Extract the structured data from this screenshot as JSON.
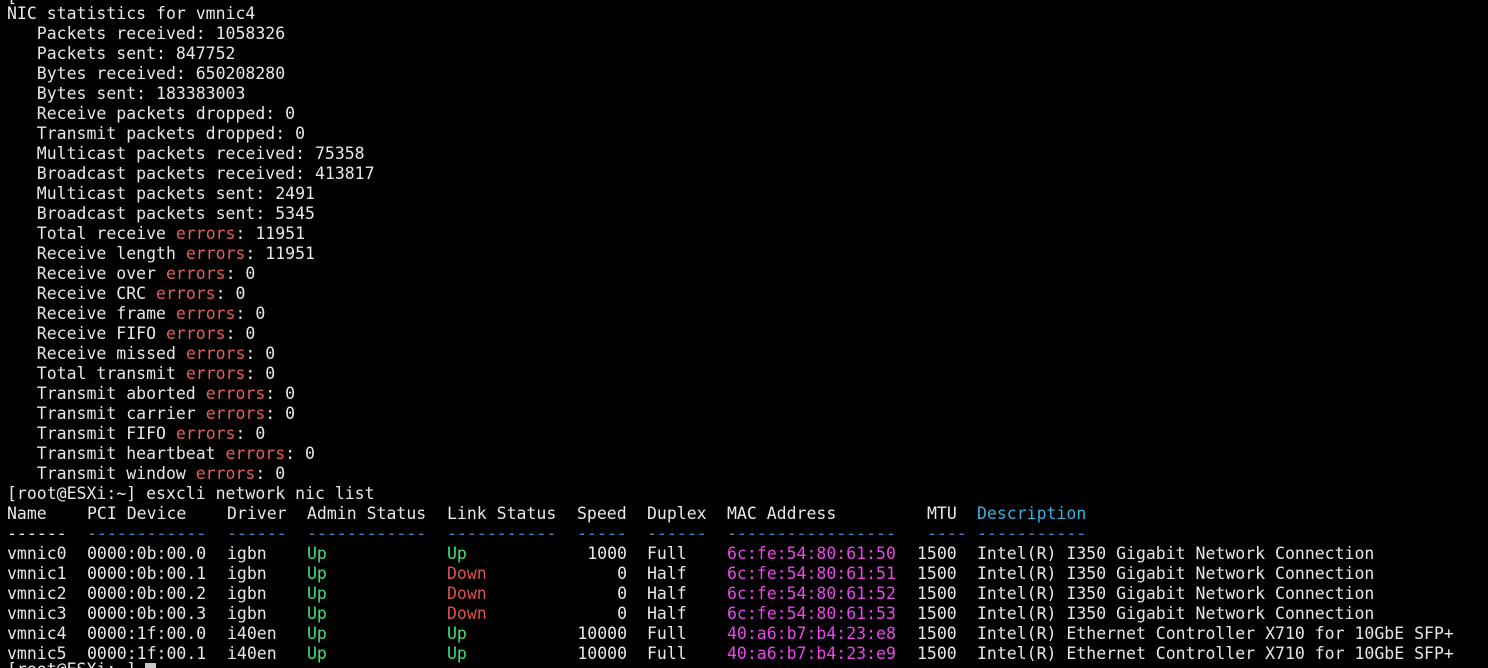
{
  "terminal": {
    "stats_title": "NIC statistics for vmnic4",
    "stats": [
      {
        "pre": "   Packets received: 1058326",
        "err": "",
        "post": ""
      },
      {
        "pre": "   Packets sent: 847752",
        "err": "",
        "post": ""
      },
      {
        "pre": "   Bytes received: 650208280",
        "err": "",
        "post": ""
      },
      {
        "pre": "   Bytes sent: 183383003",
        "err": "",
        "post": ""
      },
      {
        "pre": "   Receive packets dropped: 0",
        "err": "",
        "post": ""
      },
      {
        "pre": "   Transmit packets dropped: 0",
        "err": "",
        "post": ""
      },
      {
        "pre": "   Multicast packets received: 75358",
        "err": "",
        "post": ""
      },
      {
        "pre": "   Broadcast packets received: 413817",
        "err": "",
        "post": ""
      },
      {
        "pre": "   Multicast packets sent: 2491",
        "err": "",
        "post": ""
      },
      {
        "pre": "   Broadcast packets sent: 5345",
        "err": "",
        "post": ""
      },
      {
        "pre": "   Total receive ",
        "err": "errors",
        "post": ": 11951"
      },
      {
        "pre": "   Receive length ",
        "err": "errors",
        "post": ": 11951"
      },
      {
        "pre": "   Receive over ",
        "err": "errors",
        "post": ": 0"
      },
      {
        "pre": "   Receive CRC ",
        "err": "errors",
        "post": ": 0"
      },
      {
        "pre": "   Receive frame ",
        "err": "errors",
        "post": ": 0"
      },
      {
        "pre": "   Receive FIFO ",
        "err": "errors",
        "post": ": 0"
      },
      {
        "pre": "   Receive missed ",
        "err": "errors",
        "post": ": 0"
      },
      {
        "pre": "   Total transmit ",
        "err": "errors",
        "post": ": 0"
      },
      {
        "pre": "   Transmit aborted ",
        "err": "errors",
        "post": ": 0"
      },
      {
        "pre": "   Transmit carrier ",
        "err": "errors",
        "post": ": 0"
      },
      {
        "pre": "   Transmit FIFO ",
        "err": "errors",
        "post": ": 0"
      },
      {
        "pre": "   Transmit heartbeat ",
        "err": "errors",
        "post": ": 0"
      },
      {
        "pre": "   Transmit window ",
        "err": "errors",
        "post": ": 0"
      }
    ],
    "prompt": "[root@ESXi:~] esxcli network nic list",
    "top_fragment": "[",
    "bottom_fragment": "[root@ESXi:~] ",
    "table": {
      "headers": [
        "Name",
        "PCI Device",
        "Driver",
        "Admin Status",
        "Link Status",
        "Speed",
        "Duplex",
        "MAC Address",
        "MTU",
        "Description"
      ],
      "dashes": [
        "------",
        "------------",
        "------",
        "------------",
        "-----------",
        "-----",
        "------",
        "-----------------",
        "----",
        "-----------"
      ],
      "rows": [
        [
          "vmnic0",
          "0000:0b:00.0",
          "igbn",
          "Up",
          "Up",
          "1000",
          "Full",
          "6c:fe:54:80:61:50",
          "1500",
          "Intel(R) I350 Gigabit Network Connection"
        ],
        [
          "vmnic1",
          "0000:0b:00.1",
          "igbn",
          "Up",
          "Down",
          "0",
          "Half",
          "6c:fe:54:80:61:51",
          "1500",
          "Intel(R) I350 Gigabit Network Connection"
        ],
        [
          "vmnic2",
          "0000:0b:00.2",
          "igbn",
          "Up",
          "Down",
          "0",
          "Half",
          "6c:fe:54:80:61:52",
          "1500",
          "Intel(R) I350 Gigabit Network Connection"
        ],
        [
          "vmnic3",
          "0000:0b:00.3",
          "igbn",
          "Up",
          "Down",
          "0",
          "Half",
          "6c:fe:54:80:61:53",
          "1500",
          "Intel(R) I350 Gigabit Network Connection"
        ],
        [
          "vmnic4",
          "0000:1f:00.0",
          "i40en",
          "Up",
          "Up",
          "10000",
          "Full",
          "40:a6:b7:b4:23:e8",
          "1500",
          "Intel(R) Ethernet Controller X710 for 10GbE SFP+"
        ],
        [
          "vmnic5",
          "0000:1f:00.1",
          "i40en",
          "Up",
          "Up",
          "10000",
          "Full",
          "40:a6:b7:b4:23:e9",
          "1500",
          "Intel(R) Ethernet Controller X710 for 10GbE SFP+"
        ]
      ]
    }
  }
}
